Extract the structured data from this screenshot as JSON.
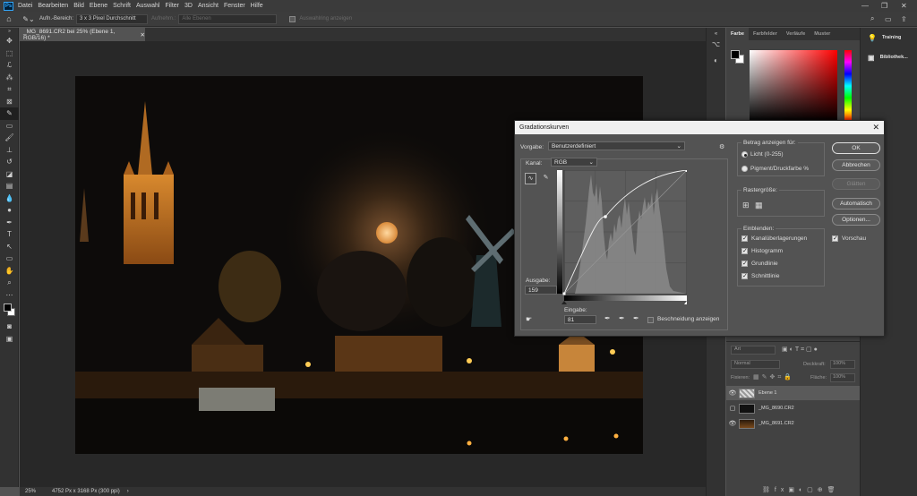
{
  "app": {
    "logo": "Ps"
  },
  "menu": [
    "Datei",
    "Bearbeiten",
    "Bild",
    "Ebene",
    "Schrift",
    "Auswahl",
    "Filter",
    "3D",
    "Ansicht",
    "Fenster",
    "Hilfe"
  ],
  "options": {
    "sample_label": "Aufn.-Bereich:",
    "sample_value": "3 x 3 Pixel Durchschnitt",
    "capture_label": "Aufnehm.:",
    "capture_value": "Alle Ebenen",
    "ring_label": "Auswahlring anzeigen"
  },
  "document": {
    "tab_title": "_MG_8691.CR2 bei 25% (Ebene 1, RGB/16) *"
  },
  "status": {
    "zoom": "25%",
    "info": "4752 Px x 3168 Px (300 ppi)"
  },
  "panels": {
    "tabs": [
      "Farbe",
      "Farbfelder",
      "Verläufe",
      "Muster"
    ],
    "far_right": [
      "Training",
      "Bibliothek..."
    ],
    "layers": {
      "search_placeholder": "Art",
      "mode": "Normal",
      "opacity_label": "Deckkraft:",
      "opacity_value": "100%",
      "fix_label": "Fixieren:",
      "fill_label": "Fläche:",
      "fill_value": "100%",
      "items": [
        "Ebene 1",
        "_MG_8690.CR2",
        "_MG_8691.CR2"
      ]
    }
  },
  "dialog": {
    "title": "Gradationskurven",
    "preset_label": "Vorgabe:",
    "preset_value": "Benutzerdefiniert",
    "channel_label": "Kanal:",
    "channel_value": "RGB",
    "output_label": "Ausgabe:",
    "output_value": "159",
    "input_label": "Eingabe:",
    "input_value": "81",
    "clipping_label": "Beschneidung anzeigen",
    "amount_title": "Betrag anzeigen für:",
    "light_label": "Licht (0-255)",
    "pigment_label": "Pigment/Druckfarbe %",
    "grid_title": "Rastergröße:",
    "show_title": "Einblenden:",
    "show_items": [
      "Kanalüberlagerungen",
      "Histogramm",
      "Grundlinie",
      "Schnittlinie"
    ],
    "buttons": [
      "OK",
      "Abbrechen",
      "Glätten",
      "Automatisch",
      "Optionen..."
    ],
    "preview_label": "Vorschau"
  }
}
